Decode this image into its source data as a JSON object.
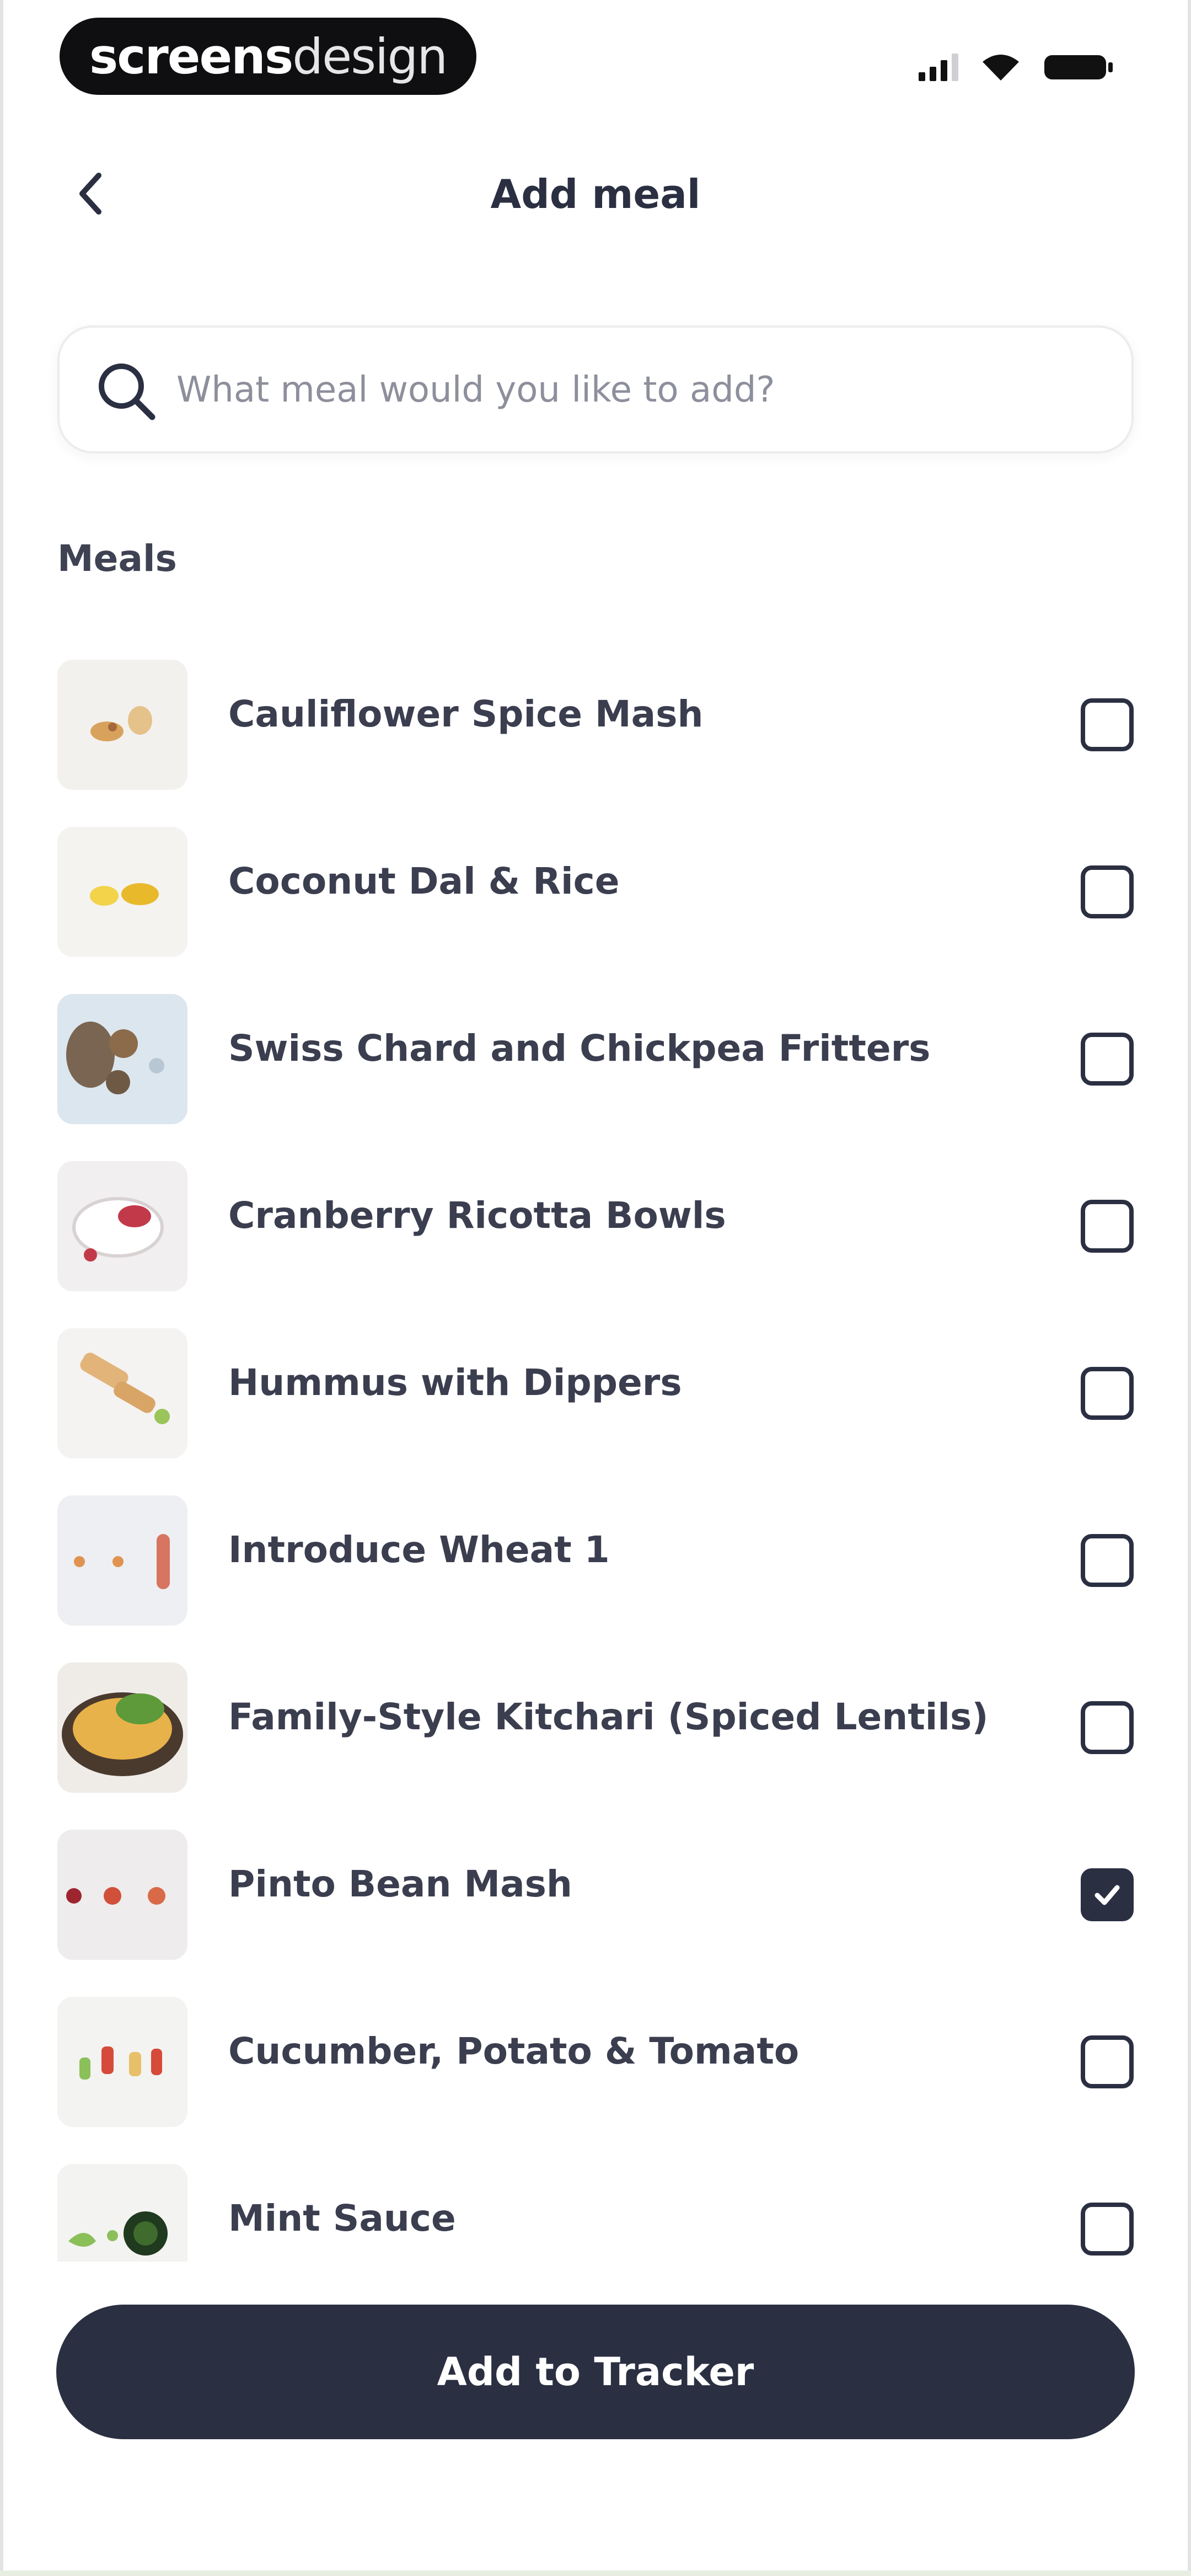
{
  "status_bar": {
    "brand_bold": "screens",
    "brand_light": "design"
  },
  "header": {
    "title": "Add meal"
  },
  "search": {
    "placeholder": "What meal would you like to add?",
    "value": ""
  },
  "section": {
    "label": "Meals"
  },
  "meals": [
    {
      "name": "Cauliflower Spice Mash",
      "checked": false
    },
    {
      "name": "Coconut Dal & Rice",
      "checked": false
    },
    {
      "name": "Swiss Chard and Chickpea Fritters",
      "checked": false
    },
    {
      "name": "Cranberry Ricotta Bowls",
      "checked": false
    },
    {
      "name": "Hummus with Dippers",
      "checked": false
    },
    {
      "name": "Introduce Wheat 1",
      "checked": false
    },
    {
      "name": "Family-Style Kitchari (Spiced Lentils)",
      "checked": false
    },
    {
      "name": "Pinto Bean Mash",
      "checked": true
    },
    {
      "name": "Cucumber, Potato & Tomato",
      "checked": false
    },
    {
      "name": "Mint Sauce",
      "checked": false
    }
  ],
  "footer": {
    "button_label": "Add to Tracker"
  },
  "colors": {
    "primary": "#2b2f42",
    "text": "#3b3e4f",
    "placeholder": "#8d8f9c"
  }
}
